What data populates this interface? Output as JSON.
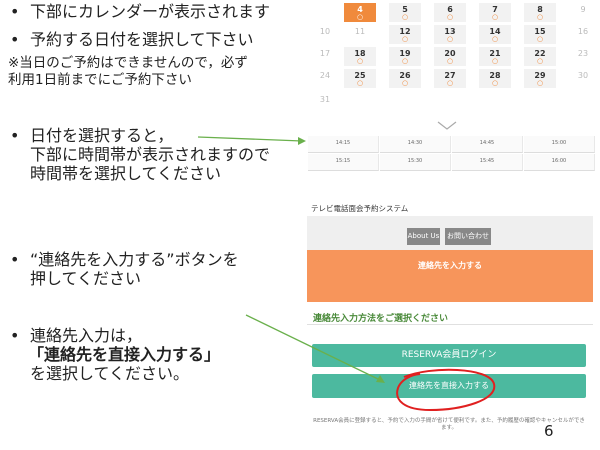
{
  "instructions": {
    "b1": "下部にカレンダーが表示されます",
    "b2": "予約する日付を選択して下さい",
    "note_line1": "※当日のご予約はできませんので，必ず",
    "note_line2": "利用1日前までにご予約下さい",
    "b3_line1": "日付を選択すると，",
    "b3_line2": "下部に時間帯が表示されますので",
    "b3_line3": "時間帯を選択してください",
    "b4_line1": "“連絡先を入力する”ボタンを",
    "b4_line2": "押してください",
    "b5_line1": "連絡先入力は，",
    "b5_line2": "「連絡先を直接入力する」",
    "b5_line3": "を選択してください。",
    "bullet": "•"
  },
  "calendar": {
    "rows": [
      [
        "",
        "4",
        "5",
        "6",
        "7",
        "8",
        "9"
      ],
      [
        "10",
        "11",
        "12",
        "13",
        "14",
        "15",
        "16"
      ],
      [
        "17",
        "18",
        "19",
        "20",
        "21",
        "22",
        "23"
      ],
      [
        "24",
        "25",
        "26",
        "27",
        "28",
        "29",
        "30"
      ],
      [
        "31",
        "",
        "",
        "",
        "",
        "",
        ""
      ]
    ],
    "mark": "○",
    "selected": "4"
  },
  "time_slots": [
    [
      "14:15",
      "14:30",
      "14:45",
      "15:00"
    ],
    [
      "15:15",
      "15:30",
      "15:45",
      "16:00"
    ]
  ],
  "panel": {
    "system_title": "テレビ電話面会予約システム",
    "about_label": "About Us",
    "contact_label": "お問い合わせ",
    "enter_contact_label": "連絡先を入力する",
    "choose_method_heading": "連絡先入力方法をご選択ください",
    "reserva_login_label": "RESERVA会員ログイン",
    "direct_entry_label": "連絡先を直接入力する",
    "footnote": "RESERVA会員に登録すると、予約で入力の手間が省けて便利です。また、予約履歴の確認やキャンセルができます。"
  },
  "page_number": "6",
  "colors": {
    "accent_orange": "#f08a3c",
    "band_orange": "#f7955b",
    "teal_button": "#4cb99f",
    "arrow_green": "#6ab04c",
    "annotation_red": "#e02020"
  }
}
